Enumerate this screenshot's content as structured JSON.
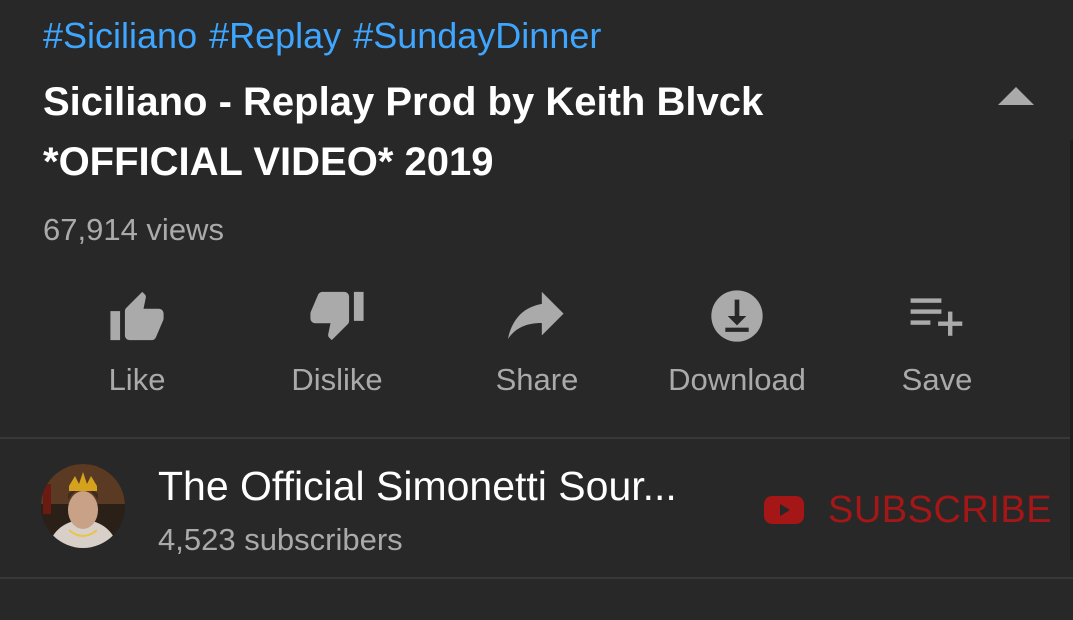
{
  "hashtags": [
    "#Siciliano",
    "#Replay",
    "#SundayDinner"
  ],
  "video": {
    "title_line1": "Siciliano - Replay Prod by Keith Blvck",
    "title_line2": "*OFFICIAL VIDEO* 2019",
    "views": "67,914 views"
  },
  "actions": {
    "like": {
      "label": "Like",
      "icon": "thumbs-up-icon"
    },
    "dislike": {
      "label": "Dislike",
      "icon": "thumbs-down-icon"
    },
    "share": {
      "label": "Share",
      "icon": "share-arrow-icon"
    },
    "download": {
      "label": "Download",
      "icon": "download-icon"
    },
    "save": {
      "label": "Save",
      "icon": "playlist-add-icon"
    }
  },
  "channel": {
    "name": "The Official Simonetti Sour...",
    "subscribers": "4,523 subscribers",
    "subscribe_label": "SUBSCRIBE"
  },
  "colors": {
    "background": "#282828",
    "hashtag": "#3ea6ff",
    "secondary_text": "#aaaaaa",
    "subscribe": "#a51616"
  }
}
